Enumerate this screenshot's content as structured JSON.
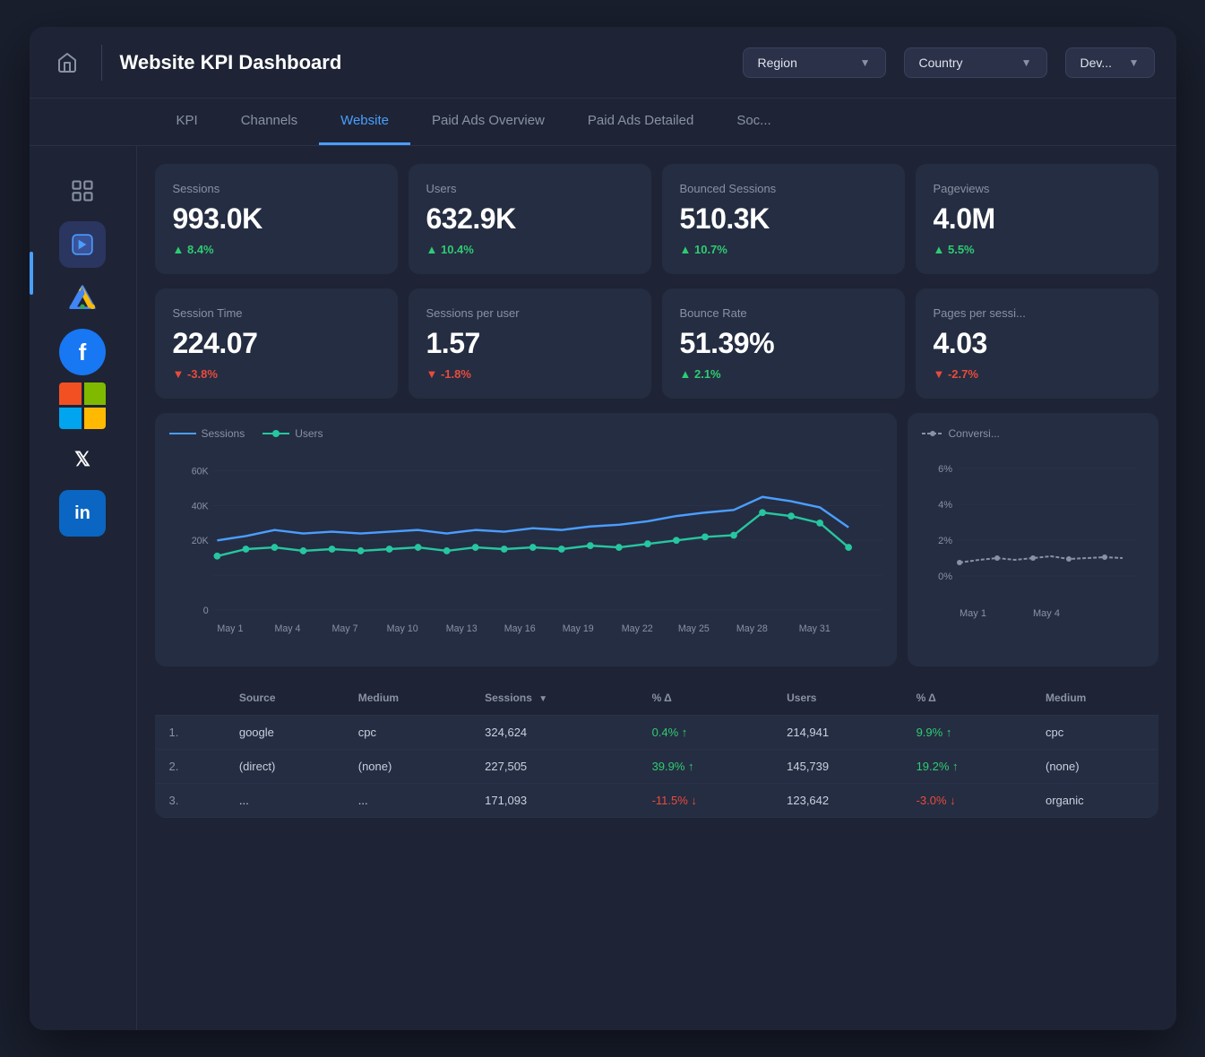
{
  "header": {
    "title": "Website KPI Dashboard",
    "region_label": "Region",
    "country_label": "Country",
    "device_label": "Dev..."
  },
  "tabs": [
    {
      "id": "kpi",
      "label": "KPI"
    },
    {
      "id": "channels",
      "label": "Channels"
    },
    {
      "id": "website",
      "label": "Website",
      "active": true
    },
    {
      "id": "paid-ads-overview",
      "label": "Paid Ads Overview"
    },
    {
      "id": "paid-ads-detailed",
      "label": "Paid Ads Detailed"
    },
    {
      "id": "soc",
      "label": "Soc..."
    }
  ],
  "kpi_cards_row1": [
    {
      "id": "sessions",
      "label": "Sessions",
      "value": "993.0K",
      "change": "8.4%",
      "direction": "up"
    },
    {
      "id": "users",
      "label": "Users",
      "value": "632.9K",
      "change": "10.4%",
      "direction": "up"
    },
    {
      "id": "bounced-sessions",
      "label": "Bounced Sessions",
      "value": "510.3K",
      "change": "10.7%",
      "direction": "up"
    },
    {
      "id": "pageviews",
      "label": "Pageviews",
      "value": "4.0M",
      "change": "5.5%",
      "direction": "up"
    }
  ],
  "kpi_cards_row2": [
    {
      "id": "session-time",
      "label": "Session Time",
      "value": "224.07",
      "change": "-3.8%",
      "direction": "down"
    },
    {
      "id": "sessions-per-user",
      "label": "Sessions per user",
      "value": "1.57",
      "change": "-1.8%",
      "direction": "down"
    },
    {
      "id": "bounce-rate",
      "label": "Bounce Rate",
      "value": "51.39%",
      "change": "2.1%",
      "direction": "up"
    },
    {
      "id": "pages-per-session",
      "label": "Pages per sessi...",
      "value": "4.03",
      "change": "-2.7%",
      "direction": "down"
    }
  ],
  "chart": {
    "legend": [
      {
        "label": "Sessions",
        "color": "#4a9eff"
      },
      {
        "label": "Users",
        "color": "#26c6a0"
      }
    ],
    "y_labels": [
      "60K",
      "40K",
      "20K",
      "0"
    ],
    "x_labels": [
      "May 1",
      "May 4",
      "May 7",
      "May 10",
      "May 13",
      "May 16",
      "May 19",
      "May 22",
      "May 25",
      "May 28",
      "May 31"
    ]
  },
  "mini_chart": {
    "legend_label": "Conversi...",
    "y_labels": [
      "6%",
      "4%",
      "2%",
      "0%"
    ],
    "x_labels": [
      "May 1",
      "May 4"
    ]
  },
  "table": {
    "headers": [
      "",
      "Source",
      "Medium",
      "Sessions ▼",
      "% Δ",
      "Users",
      "% Δ",
      "Medium"
    ],
    "rows": [
      {
        "num": "1.",
        "source": "google",
        "medium": "cpc",
        "sessions": "324,624",
        "sessions_pct": "0.4%",
        "sessions_dir": "up",
        "users": "214,941",
        "users_pct": "9.9%",
        "users_dir": "up",
        "medium2": "cpc"
      },
      {
        "num": "2.",
        "source": "(direct)",
        "medium": "(none)",
        "sessions": "227,505",
        "sessions_pct": "39.9%",
        "sessions_dir": "up",
        "users": "145,739",
        "users_pct": "19.2%",
        "users_dir": "up",
        "medium2": "(none)"
      },
      {
        "num": "3.",
        "source": "...",
        "medium": "...",
        "sessions": "171,093",
        "sessions_pct": "-11.5%",
        "sessions_dir": "down",
        "users": "123,642",
        "users_pct": "-3.0%",
        "users_dir": "down",
        "medium2": "organic"
      }
    ]
  }
}
